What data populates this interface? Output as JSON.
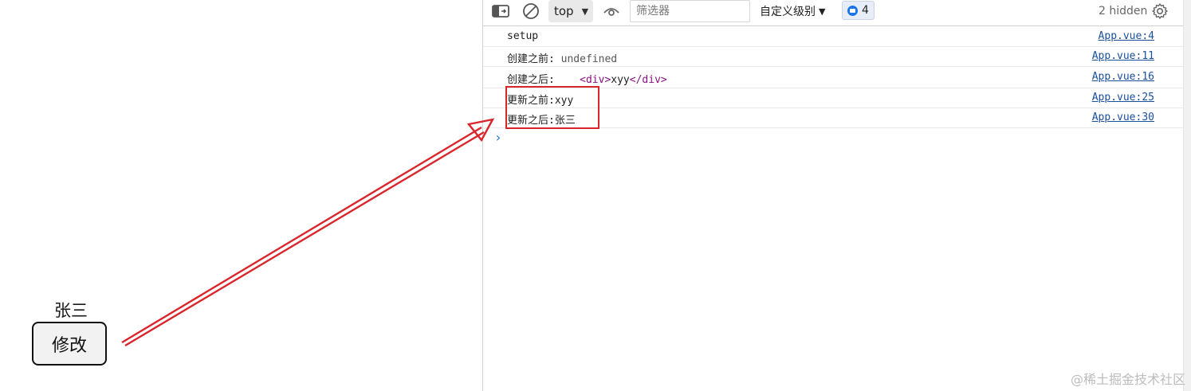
{
  "app": {
    "name_text": "张三",
    "button_label": "修改"
  },
  "toolbar": {
    "context": "top",
    "filter_placeholder": "筛选器",
    "levels": "自定义级别",
    "issues_count": "4",
    "hidden": "2 hidden"
  },
  "console": {
    "rows": [
      {
        "label": "setup",
        "value": "",
        "source": "App.vue:4"
      },
      {
        "label": "创建之前:",
        "value": "undefined",
        "source": "App.vue:11"
      },
      {
        "label": "创建之后:",
        "value_tag_open": "<div>",
        "value_text": "xyy",
        "value_tag_close": "</div>",
        "source": "App.vue:16"
      },
      {
        "label": "更新之前:xyy",
        "value": "",
        "source": "App.vue:25"
      },
      {
        "label": "更新之后:张三",
        "value": "",
        "source": "App.vue:30"
      }
    ]
  },
  "colors": {
    "annotation": "#d9262c",
    "link": "#1a4f9c",
    "prompt": "#1a73e8"
  },
  "watermark": "@稀土掘金技术社区"
}
